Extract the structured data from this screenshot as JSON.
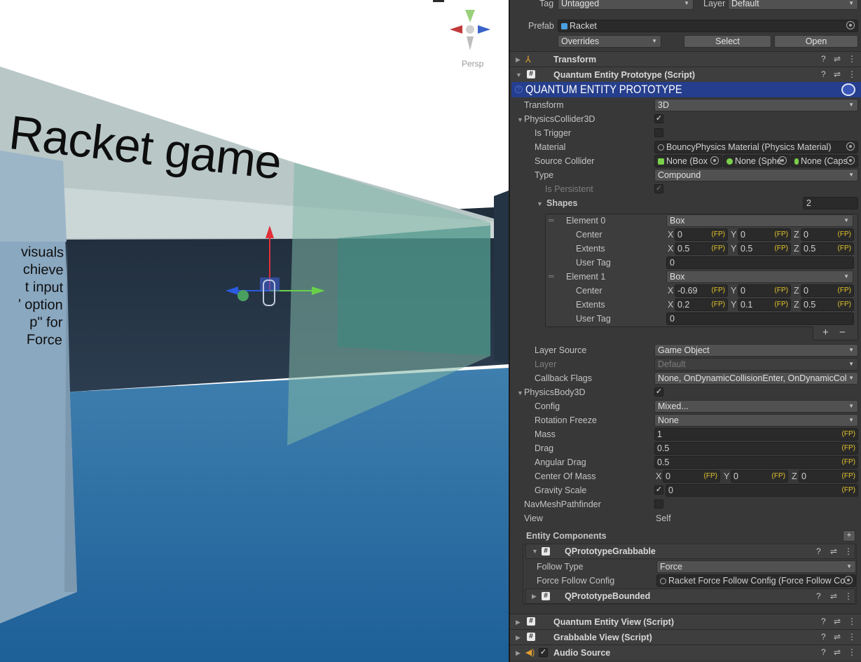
{
  "scene": {
    "title_text": "Racket game",
    "panel_lines": [
      "visuals",
      "chieve",
      "t input",
      "' option",
      "p\" for",
      "Force"
    ],
    "camera_mode": "Persp"
  },
  "header": {
    "tag_label": "Tag",
    "tag_value": "Untagged",
    "layer_label": "Layer",
    "layer_value": "Default",
    "prefab_label": "Prefab",
    "prefab_value": "Racket",
    "overrides": "Overrides",
    "select": "Select",
    "open": "Open"
  },
  "transform_comp": {
    "title": "Transform"
  },
  "qep": {
    "title": "Quantum Entity Prototype (Script)",
    "banner": "QUANTUM ENTITY PROTOTYPE",
    "transform_label": "Transform",
    "transform_value": "3D",
    "collider": {
      "label": "PhysicsCollider3D",
      "enabled": true,
      "is_trigger_label": "Is Trigger",
      "is_trigger": false,
      "material_label": "Material",
      "material_value": "BouncyPhysics Material (Physics Material)",
      "source_label": "Source Collider",
      "source_box": "None (Box",
      "source_sphere": "None (Sphe",
      "source_capsule": "None (Caps",
      "type_label": "Type",
      "type_value": "Compound",
      "persistent_label": "Is Persistent",
      "persistent": true,
      "shapes_label": "Shapes",
      "shapes_count": "2",
      "elements": [
        {
          "name": "Element 0",
          "shape": "Box",
          "center_label": "Center",
          "center": [
            "0",
            "0",
            "0"
          ],
          "extents_label": "Extents",
          "extents": [
            "0.5",
            "0.5",
            "0.5"
          ],
          "user_tag_label": "User Tag",
          "user_tag": "0"
        },
        {
          "name": "Element 1",
          "shape": "Box",
          "center_label": "Center",
          "center": [
            "-0.69",
            "0",
            "0"
          ],
          "extents_label": "Extents",
          "extents": [
            "0.2",
            "0.1",
            "0.5"
          ],
          "user_tag_label": "User Tag",
          "user_tag": "0"
        }
      ],
      "add": "+",
      "remove": "−",
      "layer_source_label": "Layer Source",
      "layer_source_value": "Game Object",
      "layer_label": "Layer",
      "layer_value": "Default",
      "callback_label": "Callback Flags",
      "callback_value": "None, OnDynamicCollisionEnter, OnDynamicCol"
    },
    "body": {
      "label": "PhysicsBody3D",
      "enabled": true,
      "config_label": "Config",
      "config_value": "Mixed...",
      "rotation_label": "Rotation Freeze",
      "rotation_value": "None",
      "mass_label": "Mass",
      "mass_value": "1",
      "drag_label": "Drag",
      "drag_value": "0.5",
      "angular_label": "Angular Drag",
      "angular_value": "0.5",
      "com_label": "Center Of Mass",
      "com": [
        "0",
        "0",
        "0"
      ],
      "gravity_label": "Gravity Scale",
      "gravity_enabled": true,
      "gravity_value": "0"
    },
    "navmesh_label": "NavMeshPathfinder",
    "navmesh": false,
    "view_label": "View",
    "view_value": "Self",
    "entity_components": {
      "label": "Entity Components",
      "add": "+",
      "grabbable": {
        "title": "QPrototypeGrabbable",
        "follow_type_label": "Follow Type",
        "follow_type_value": "Force",
        "force_config_label": "Force Follow Config",
        "force_config_value": "Racket Force Follow Config (Force Follow Co"
      },
      "bounded": {
        "title": "QPrototypeBounded"
      }
    }
  },
  "fp_tag": "(FP)",
  "axes": {
    "x": "X",
    "y": "Y",
    "z": "Z"
  },
  "other_components": [
    {
      "title": "Quantum Entity View (Script)"
    },
    {
      "title": "Grabbable View (Script)"
    },
    {
      "title": "Audio Source"
    }
  ],
  "colors": {
    "banner": "#253e8d",
    "fp": "#e2c22a",
    "axis_x": "#e0303a",
    "axis_y": "#6ad04a",
    "axis_z": "#2a5ae0"
  }
}
